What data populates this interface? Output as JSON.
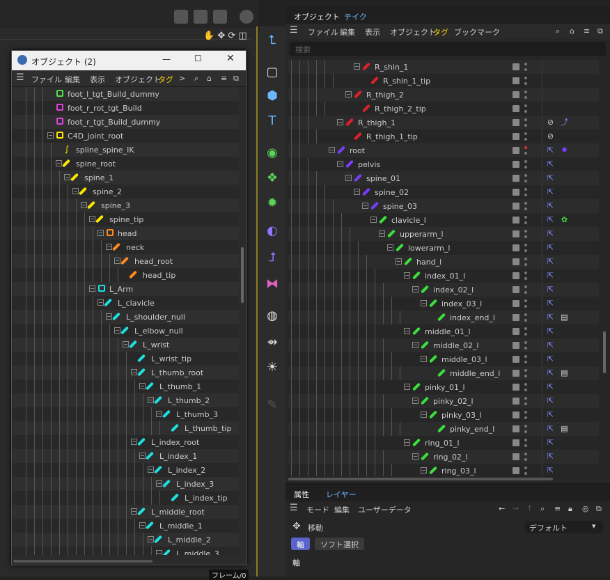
{
  "viewport": {
    "frame_label": "フレーム/0"
  },
  "floating": {
    "title": "オブジェクト (2)",
    "menu": [
      "ファイル",
      "編集",
      "表示",
      "オブジェクト",
      "タグ",
      ">"
    ],
    "rows": [
      {
        "label": "foot_l_tgt_Build_dummy",
        "d": 4,
        "t": "null",
        "c": "#4fe04f"
      },
      {
        "label": "foot_r_rot_tgt_Build",
        "d": 4,
        "t": "null",
        "c": "#e040e0"
      },
      {
        "label": "foot_r_tgt_Build_dummy",
        "d": 4,
        "t": "null",
        "c": "#e040e0"
      },
      {
        "label": "C4D_joint_root",
        "d": 4,
        "t": "null",
        "c": "#ffe600",
        "e": 1
      },
      {
        "label": "spline_spine_IK",
        "d": 5,
        "t": "spline",
        "c": "#ffe600"
      },
      {
        "label": "spine_root",
        "d": 5,
        "t": "bone",
        "c": "#ffe600",
        "e": 1
      },
      {
        "label": "spine_1",
        "d": 6,
        "t": "bone",
        "c": "#ffe600",
        "e": 1
      },
      {
        "label": "spine_2",
        "d": 7,
        "t": "bone",
        "c": "#ffe600",
        "e": 1
      },
      {
        "label": "spine_3",
        "d": 8,
        "t": "bone",
        "c": "#ffe600",
        "e": 1
      },
      {
        "label": "spine_tip",
        "d": 9,
        "t": "bone",
        "c": "#ffe600",
        "e": 1
      },
      {
        "label": "head",
        "d": 10,
        "t": "null",
        "c": "#ff8a1e",
        "e": 1
      },
      {
        "label": "neck",
        "d": 11,
        "t": "bone",
        "c": "#ff8a1e",
        "e": 1
      },
      {
        "label": "head_root",
        "d": 12,
        "t": "bone",
        "c": "#ff8a1e",
        "e": 1
      },
      {
        "label": "head_tip",
        "d": 13,
        "t": "bone",
        "c": "#ff8a1e"
      },
      {
        "label": "L_Arm",
        "d": 9,
        "t": "null",
        "c": "#1ee0e0",
        "e": 1
      },
      {
        "label": "L_clavicle",
        "d": 10,
        "t": "bone",
        "c": "#1ee0e0",
        "e": 1
      },
      {
        "label": "L_shoulder_null",
        "d": 11,
        "t": "bone",
        "c": "#1ee0e0",
        "e": 1
      },
      {
        "label": "L_elbow_null",
        "d": 12,
        "t": "bone",
        "c": "#1ee0e0",
        "e": 1
      },
      {
        "label": "L_wrist",
        "d": 13,
        "t": "bone",
        "c": "#1ee0e0",
        "e": 1
      },
      {
        "label": "L_wrist_tip",
        "d": 14,
        "t": "bone",
        "c": "#1ee0e0"
      },
      {
        "label": "L_thumb_root",
        "d": 14,
        "t": "bone",
        "c": "#1ee0e0",
        "e": 1
      },
      {
        "label": "L_thumb_1",
        "d": 15,
        "t": "bone",
        "c": "#1ee0e0",
        "e": 1
      },
      {
        "label": "L_thumb_2",
        "d": 16,
        "t": "bone",
        "c": "#1ee0e0",
        "e": 1
      },
      {
        "label": "L_thumb_3",
        "d": 17,
        "t": "bone",
        "c": "#1ee0e0",
        "e": 1
      },
      {
        "label": "L_thumb_tip",
        "d": 18,
        "t": "bone",
        "c": "#1ee0e0"
      },
      {
        "label": "L_index_root",
        "d": 14,
        "t": "bone",
        "c": "#1ee0e0",
        "e": 1
      },
      {
        "label": "L_index_1",
        "d": 15,
        "t": "bone",
        "c": "#1ee0e0",
        "e": 1
      },
      {
        "label": "L_index_2",
        "d": 16,
        "t": "bone",
        "c": "#1ee0e0",
        "e": 1
      },
      {
        "label": "L_index_3",
        "d": 17,
        "t": "bone",
        "c": "#1ee0e0",
        "e": 1
      },
      {
        "label": "L_index_tip",
        "d": 18,
        "t": "bone",
        "c": "#1ee0e0"
      },
      {
        "label": "L_middle_root",
        "d": 14,
        "t": "bone",
        "c": "#1ee0e0",
        "e": 1
      },
      {
        "label": "L_middle_1",
        "d": 15,
        "t": "bone",
        "c": "#1ee0e0",
        "e": 1
      },
      {
        "label": "L_middle_2",
        "d": 16,
        "t": "bone",
        "c": "#1ee0e0",
        "e": 1
      },
      {
        "label": "L_middle_3",
        "d": 17,
        "t": "bone",
        "c": "#1ee0e0",
        "e": 1
      }
    ]
  },
  "objmgr": {
    "tabs": [
      "オブジェクト",
      "テイク"
    ],
    "menu": [
      "ファイル",
      "編集",
      "表示",
      "オブジェクト",
      "タグ",
      "ブックマーク"
    ],
    "search_placeholder": "検索",
    "rows": [
      {
        "label": "R_shin_1",
        "d": 4,
        "c": "#e0202a",
        "e": 1
      },
      {
        "label": "R_shin_1_tip",
        "d": 5,
        "c": "#e0202a"
      },
      {
        "label": "R_thigh_2",
        "d": 3,
        "c": "#e0202a",
        "e": 1
      },
      {
        "label": "R_thigh_2_tip",
        "d": 4,
        "c": "#e0202a"
      },
      {
        "label": "R_thigh_1",
        "d": 2,
        "c": "#e0202a",
        "e": 1,
        "tags": [
          "no",
          "ik"
        ]
      },
      {
        "label": "R_thigh_1_tip",
        "d": 3,
        "c": "#e0202a",
        "tags": [
          "no"
        ]
      },
      {
        "label": "root",
        "d": 1,
        "c": "#7a3cff",
        "e": 1,
        "red": 1,
        "tags": [
          "pin",
          "gear"
        ]
      },
      {
        "label": "pelvis",
        "d": 2,
        "c": "#7a3cff",
        "e": 1,
        "tags": [
          "pin"
        ]
      },
      {
        "label": "spine_01",
        "d": 3,
        "c": "#7a3cff",
        "e": 1,
        "tags": [
          "pin"
        ]
      },
      {
        "label": "spine_02",
        "d": 4,
        "c": "#7a3cff",
        "e": 1,
        "tags": [
          "pin"
        ]
      },
      {
        "label": "spine_03",
        "d": 5,
        "c": "#7a3cff",
        "e": 1,
        "tags": [
          "pin"
        ]
      },
      {
        "label": "clavicle_l",
        "d": 6,
        "c": "#3ce03c",
        "e": 1,
        "tags": [
          "pin",
          "star"
        ]
      },
      {
        "label": "upperarm_l",
        "d": 7,
        "c": "#3ce03c",
        "e": 1,
        "tags": [
          "pin"
        ]
      },
      {
        "label": "lowerarm_l",
        "d": 8,
        "c": "#3ce03c",
        "e": 1,
        "tags": [
          "pin"
        ]
      },
      {
        "label": "hand_l",
        "d": 9,
        "c": "#3ce03c",
        "e": 1,
        "tags": [
          "pin"
        ]
      },
      {
        "label": "index_01_l",
        "d": 10,
        "c": "#3ce03c",
        "e": 1,
        "tags": [
          "pin"
        ]
      },
      {
        "label": "index_02_l",
        "d": 11,
        "c": "#3ce03c",
        "e": 1,
        "tags": [
          "pin"
        ]
      },
      {
        "label": "index_03_l",
        "d": 12,
        "c": "#3ce03c",
        "e": 1,
        "tags": [
          "pin"
        ]
      },
      {
        "label": "index_end_l",
        "d": 13,
        "c": "#3ce03c",
        "tags": [
          "pin",
          "note"
        ]
      },
      {
        "label": "middle_01_l",
        "d": 10,
        "c": "#3ce03c",
        "e": 1,
        "tags": [
          "pin"
        ]
      },
      {
        "label": "middle_02_l",
        "d": 11,
        "c": "#3ce03c",
        "e": 1,
        "tags": [
          "pin"
        ]
      },
      {
        "label": "middle_03_l",
        "d": 12,
        "c": "#3ce03c",
        "e": 1,
        "tags": [
          "pin"
        ]
      },
      {
        "label": "middle_end_l",
        "d": 13,
        "c": "#3ce03c",
        "tags": [
          "pin",
          "note"
        ]
      },
      {
        "label": "pinky_01_l",
        "d": 10,
        "c": "#3ce03c",
        "e": 1,
        "tags": [
          "pin"
        ]
      },
      {
        "label": "pinky_02_l",
        "d": 11,
        "c": "#3ce03c",
        "e": 1,
        "tags": [
          "pin"
        ]
      },
      {
        "label": "pinky_03_l",
        "d": 12,
        "c": "#3ce03c",
        "e": 1,
        "tags": [
          "pin"
        ]
      },
      {
        "label": "pinky_end_l",
        "d": 13,
        "c": "#3ce03c",
        "tags": [
          "pin",
          "note"
        ]
      },
      {
        "label": "ring_01_l",
        "d": 10,
        "c": "#3ce03c",
        "e": 1,
        "tags": [
          "pin"
        ]
      },
      {
        "label": "ring_02_l",
        "d": 11,
        "c": "#3ce03c",
        "e": 1,
        "tags": [
          "pin"
        ]
      },
      {
        "label": "ring_03_l",
        "d": 12,
        "c": "#3ce03c",
        "e": 1,
        "tags": [
          "pin"
        ]
      }
    ]
  },
  "attr": {
    "tabs": [
      "属性",
      "レイヤー"
    ],
    "menu": [
      "モード",
      "編集",
      "ユーザーデータ"
    ],
    "tool": "移動",
    "preset": "デフォルト",
    "btn_axis": "軸",
    "btn_soft": "ソフト選択",
    "section": "軸"
  }
}
